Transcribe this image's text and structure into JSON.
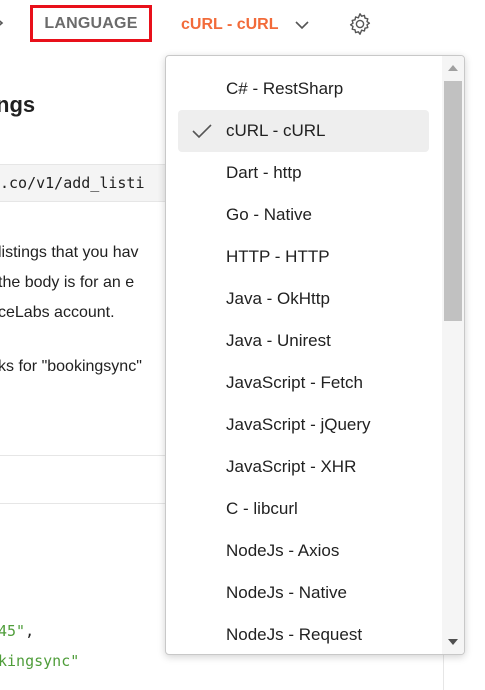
{
  "header": {
    "language_label": "LANGUAGE",
    "selected_language": "cURL - cURL"
  },
  "doc": {
    "title_fragment": "ngs",
    "url_fragment": ".co/v1/add_listi",
    "desc_lines": [
      "listings that you hav",
      "the body is for an e",
      "ceLabs account.",
      "ks for \"bookingsync\""
    ],
    "code_lines": [
      {
        "str": "45\"",
        "punc": ","
      },
      {
        "str": "kingsync\"",
        "punc": ""
      }
    ]
  },
  "dropdown": {
    "items": [
      {
        "label": "C# - RestSharp",
        "selected": false
      },
      {
        "label": "cURL - cURL",
        "selected": true
      },
      {
        "label": "Dart - http",
        "selected": false
      },
      {
        "label": "Go - Native",
        "selected": false
      },
      {
        "label": "HTTP - HTTP",
        "selected": false
      },
      {
        "label": "Java - OkHttp",
        "selected": false
      },
      {
        "label": "Java - Unirest",
        "selected": false
      },
      {
        "label": "JavaScript - Fetch",
        "selected": false
      },
      {
        "label": "JavaScript - jQuery",
        "selected": false
      },
      {
        "label": "JavaScript - XHR",
        "selected": false
      },
      {
        "label": "C - libcurl",
        "selected": false
      },
      {
        "label": "NodeJs - Axios",
        "selected": false
      },
      {
        "label": "NodeJs - Native",
        "selected": false
      },
      {
        "label": "NodeJs - Request",
        "selected": false
      }
    ]
  },
  "icons": {
    "left_chevron": "chevron-left-icon",
    "select_chevron": "chevron-down-icon",
    "settings": "gear-icon",
    "selected_mark": "checkmark-icon"
  },
  "colors": {
    "accent": "#f26b3a",
    "highlight_border": "#e8101a",
    "code_string": "#4f9d3a"
  }
}
